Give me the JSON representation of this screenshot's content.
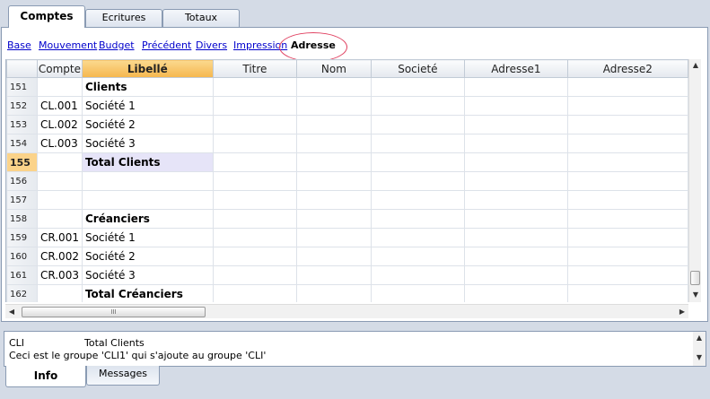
{
  "top_tabs": [
    {
      "label": "Comptes"
    },
    {
      "label": "Ecritures"
    },
    {
      "label": "Totaux"
    }
  ],
  "views": [
    {
      "label": "Base"
    },
    {
      "label": "Mouvement"
    },
    {
      "label": "Budget"
    },
    {
      "label": "Précédent"
    },
    {
      "label": "Divers"
    },
    {
      "label": "Impression"
    },
    {
      "label": "Adresse"
    }
  ],
  "active_view": "Adresse",
  "columns": [
    "",
    "Compte",
    "Libellé",
    "Titre",
    "Nom",
    "Societé",
    "Adresse1",
    "Adresse2"
  ],
  "selected_column": "Libellé",
  "rows": [
    {
      "n": "151",
      "compte": "",
      "libelle": "Clients",
      "bold": true
    },
    {
      "n": "152",
      "compte": "CL.001",
      "libelle": "Société 1"
    },
    {
      "n": "153",
      "compte": "CL.002",
      "libelle": "Société 2"
    },
    {
      "n": "154",
      "compte": "CL.003",
      "libelle": "Société 3"
    },
    {
      "n": "155",
      "compte": "",
      "libelle": "Total Clients",
      "bold": true,
      "current": true
    },
    {
      "n": "156",
      "compte": "",
      "libelle": ""
    },
    {
      "n": "157",
      "compte": "",
      "libelle": ""
    },
    {
      "n": "158",
      "compte": "",
      "libelle": "Créanciers",
      "bold": true
    },
    {
      "n": "159",
      "compte": "CR.001",
      "libelle": "Société 1"
    },
    {
      "n": "160",
      "compte": "CR.002",
      "libelle": "Société 2"
    },
    {
      "n": "161",
      "compte": "CR.003",
      "libelle": "Société 3"
    },
    {
      "n": "162",
      "compte": "",
      "libelle": "Total Créanciers",
      "bold": true
    }
  ],
  "hscroll_grip": "III",
  "info": {
    "group": "CLI",
    "description": "Total Clients",
    "message": "Ceci est le groupe 'CLI1' qui s'ajoute au groupe 'CLI'"
  },
  "bottom_tabs": [
    {
      "label": "Info"
    },
    {
      "label": "Messages"
    }
  ],
  "colors": {
    "highlight": "#f5b64d",
    "current_row": "#e6e4f8",
    "link": "#0000cc",
    "annotation_circle": "#e04060"
  }
}
